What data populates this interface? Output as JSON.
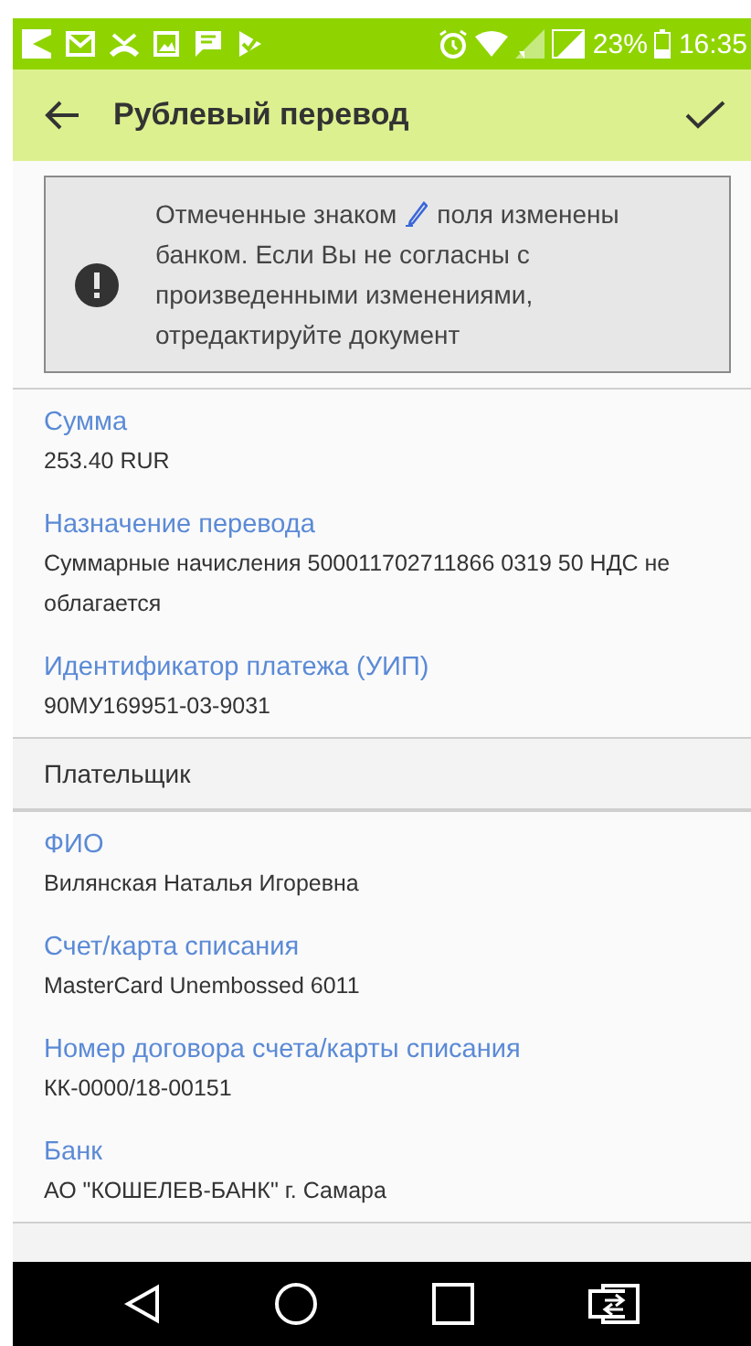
{
  "status_bar": {
    "battery": "23%",
    "time": "16:35"
  },
  "app_bar": {
    "title": "Рублевый перевод"
  },
  "notice": {
    "text_before": "Отмеченные знаком",
    "text_after": "поля изменены",
    "text_rest": "банком. Если Вы не согласны с произведенными изменениями, отредактируйте документ"
  },
  "sections": [
    {
      "kind": "fields",
      "fields": [
        {
          "label": "Сумма",
          "value": "253.40 RUR"
        },
        {
          "label": "Назначение перевода",
          "value": "Суммарные начисления 500011702711866 0319 50 НДС не облагается"
        },
        {
          "label": "Идентификатор платежа (УИП)",
          "value": "90МУ169951-03-9031"
        }
      ]
    },
    {
      "kind": "header",
      "title": "Плательщик"
    },
    {
      "kind": "fields",
      "fields": [
        {
          "label": "ФИО",
          "value": "Вилянская Наталья Игоревна"
        },
        {
          "label": "Счет/карта списания",
          "value": "MasterCard Unembossed 6011"
        },
        {
          "label": "Номер договора счета/карты списания",
          "value": "КК-0000/18-00151"
        },
        {
          "label": "Банк",
          "value": "АО \"КОШЕЛЕВ-БАНК\" г. Самара"
        }
      ]
    },
    {
      "kind": "header"
    }
  ]
}
